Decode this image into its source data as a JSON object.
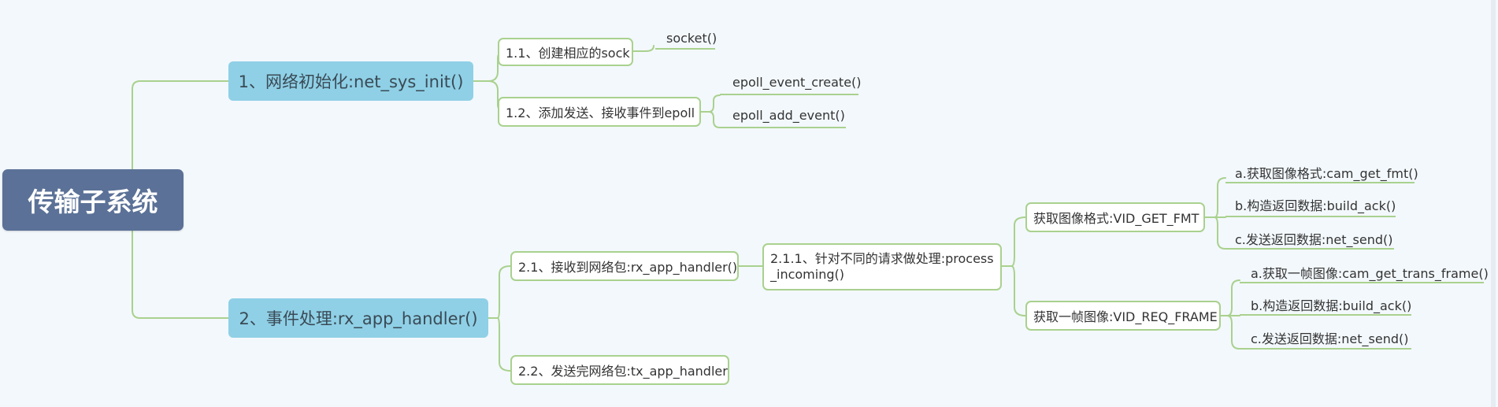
{
  "colors": {
    "background": "#f3f8fc",
    "root_fill": "#5b7197",
    "main_fill": "#8fd0e6",
    "branch_line": "#a9d18e"
  },
  "root": {
    "label": "传输子系统"
  },
  "branch1": {
    "label": "1、网络初始化:net_sys_init()",
    "sub1": {
      "label": "1.1、创建相应的sock",
      "leaves": [
        "socket()"
      ]
    },
    "sub2": {
      "label": "1.2、添加发送、接收事件到epoll",
      "leaves": [
        "epoll_event_create()",
        "epoll_add_event()"
      ]
    }
  },
  "branch2": {
    "label": "2、事件处理:rx_app_handler()",
    "sub1": {
      "label": "2.1、接收到网络包:rx_app_handler()",
      "child": {
        "label": "2.1.1、针对不同的请求做处理:process_incoming()",
        "fmt": {
          "label": "获取图像格式:VID_GET_FMT",
          "leaves": [
            "a.获取图像格式:cam_get_fmt()",
            "b.构造返回数据:build_ack()",
            "c.发送返回数据:net_send()"
          ]
        },
        "frame": {
          "label": "获取一帧图像:VID_REQ_FRAME",
          "leaves": [
            "a.获取一帧图像:cam_get_trans_frame()",
            "b.构造返回数据:build_ack()",
            "c.发送返回数据:net_send()"
          ]
        }
      }
    },
    "sub2": {
      "label": "2.2、发送完网络包:tx_app_handler"
    }
  }
}
